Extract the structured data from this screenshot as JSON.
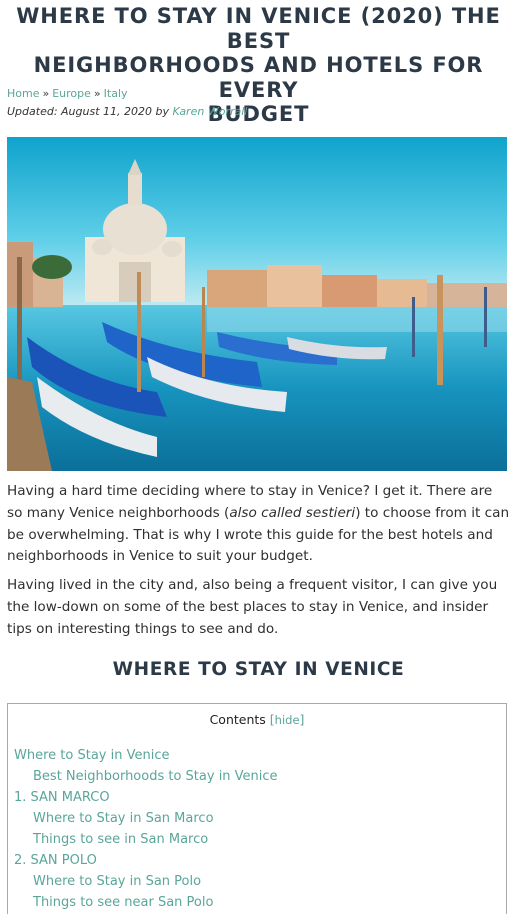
{
  "article": {
    "title_line1": "WHERE TO STAY IN VENICE (2020) THE BEST",
    "title_line2": "NEIGHBORHOODS AND HOTELS FOR EVERY",
    "title_line3": "BUDGET",
    "breadcrumb": {
      "items": [
        "Home",
        "Europe",
        "Italy"
      ],
      "separator": "»"
    },
    "updated_prefix": "Updated: August 11, 2020 by",
    "author": "Karen Worrall",
    "paragraph1": {
      "part1": "Having a hard time deciding where to stay in Venice? I get it. There are so many Venice neighborhoods (",
      "emphasis": "also called sestieri",
      "part2": ") to choose from it can be overwhelming. That is why I wrote this guide for the best hotels and neighborhoods in Venice to suit your budget."
    },
    "paragraph2": "Having lived in the city and, also being a frequent visitor, I can give you the low-down on some of the best places to stay in Venice, and insider tips on interesting things to see and do.",
    "section_heading": "WHERE TO STAY IN VENICE"
  },
  "toc": {
    "title": "Contents",
    "hide_label": "hide",
    "items": [
      "Where to Stay in Venice",
      "Best Neighborhoods to Stay in Venice",
      "1. SAN MARCO",
      "Where to Stay in San Marco",
      "Things to see in San Marco",
      "2. SAN POLO",
      "Where to Stay in San Polo",
      "Things to see near San Polo"
    ]
  },
  "colors": {
    "link": "#5aa59a",
    "heading": "#2c3a48",
    "body_text": "#2f2f2f"
  }
}
